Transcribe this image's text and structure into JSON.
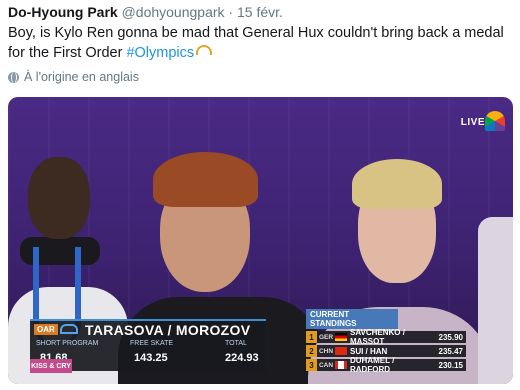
{
  "tweet": {
    "author": "Do-Hyoung Park",
    "handle": "@dohyoungpark",
    "separator": "·",
    "date": "15 févr.",
    "text": "Boy, is Kylo Ren gonna be mad that General Hux couldn't bring back a medal for the First Order ",
    "hashtag": "#Olympics",
    "translate_label": "À l'origine en anglais"
  },
  "broadcast": {
    "live_label": "LIVE",
    "scoreboard": {
      "country": "OAR",
      "names": "TARASOVA / MOROZOV",
      "columns": [
        {
          "label": "SHORT PROGRAM",
          "value": "81.68"
        },
        {
          "label": "FREE SKATE",
          "value": "143.25"
        },
        {
          "label": "TOTAL",
          "value": "224.93"
        }
      ],
      "kiss_label": "KISS & CRY"
    },
    "standings": {
      "title": "CURRENT STANDINGS",
      "rows": [
        {
          "rank": "1",
          "country": "GER",
          "name": "SAVCHENKO / MASSOT",
          "score": "235.90"
        },
        {
          "rank": "2",
          "country": "CHN",
          "name": "SUI / HAN",
          "score": "235.47"
        },
        {
          "rank": "3",
          "country": "CAN",
          "name": "DUHAMEL / RADFORD",
          "score": "230.15"
        }
      ]
    }
  }
}
